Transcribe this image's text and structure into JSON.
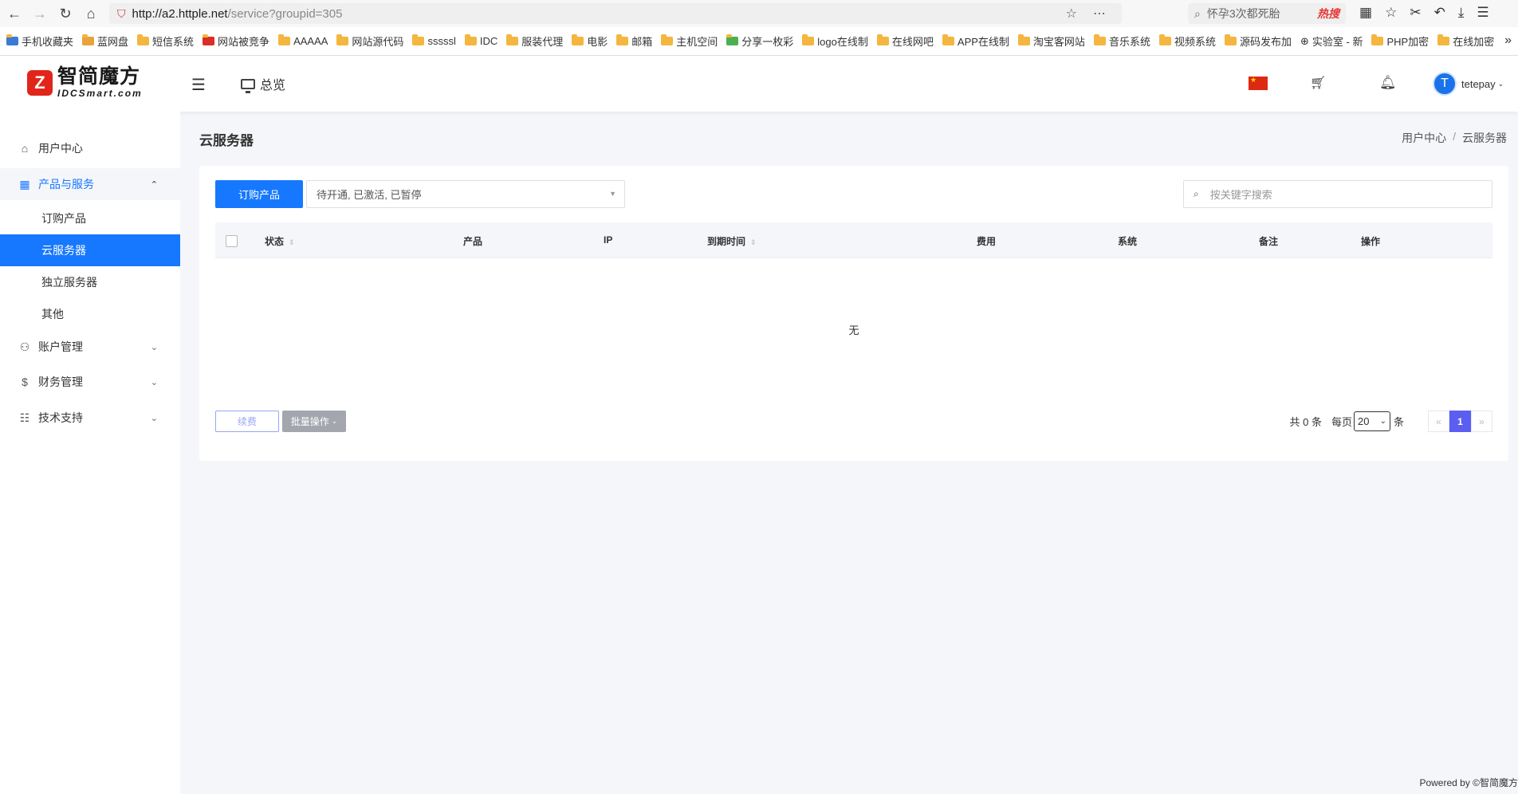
{
  "browser": {
    "url_host": "http://a2.httple.net",
    "url_path": "/service?groupid=305",
    "search_text": "怀孕3次都死胎",
    "search_hot": "热搜"
  },
  "bookmarks": [
    "手机收藏夹",
    "蓝网盘",
    "短信系统",
    "网站被竞争",
    "AAAAA",
    "网站源代码",
    "sssssl",
    "IDC",
    "服装代理",
    "电影",
    "邮箱",
    "主机空间",
    "分享一枚彩",
    "logo在线制",
    "在线网吧",
    "APP在线制",
    "淘宝客网站",
    "音乐系统",
    "视频系统",
    "源码发布加",
    "实验室 - 新",
    "PHP加密",
    "在线加密"
  ],
  "header": {
    "logo_mark": "Z",
    "logo_cn": "智简魔方",
    "logo_en": "IDCSmart.com",
    "overview_label": "总览",
    "user_initial": "T",
    "username": "tetepay"
  },
  "sidebar": {
    "user_center": "用户中心",
    "products": "产品与服务",
    "sub": [
      "订购产品",
      "云服务器",
      "独立服务器",
      "其他"
    ],
    "account": "账户管理",
    "finance": "财务管理",
    "support": "技术支持"
  },
  "page": {
    "title": "云服务器",
    "breadcrumb": [
      "用户中心",
      "云服务器"
    ]
  },
  "toolbar": {
    "order_label": "订购产品",
    "status_filter": "待开通, 已激活, 已暂停",
    "search_placeholder": "按关键字搜索"
  },
  "table": {
    "columns": [
      "状态",
      "产品",
      "IP",
      "到期时间",
      "费用",
      "系统",
      "备注",
      "操作"
    ],
    "empty_text": "无"
  },
  "footer_actions": {
    "renew_label": "续费",
    "batch_label": "批量操作"
  },
  "pagination": {
    "total": "共 0 条",
    "per_page_prefix": "每页",
    "per_page_value": "20",
    "per_page_suffix": "条",
    "prev": "«",
    "current": "1",
    "next": "»"
  },
  "footer": {
    "powered": "Powered by ©智简魔方"
  }
}
